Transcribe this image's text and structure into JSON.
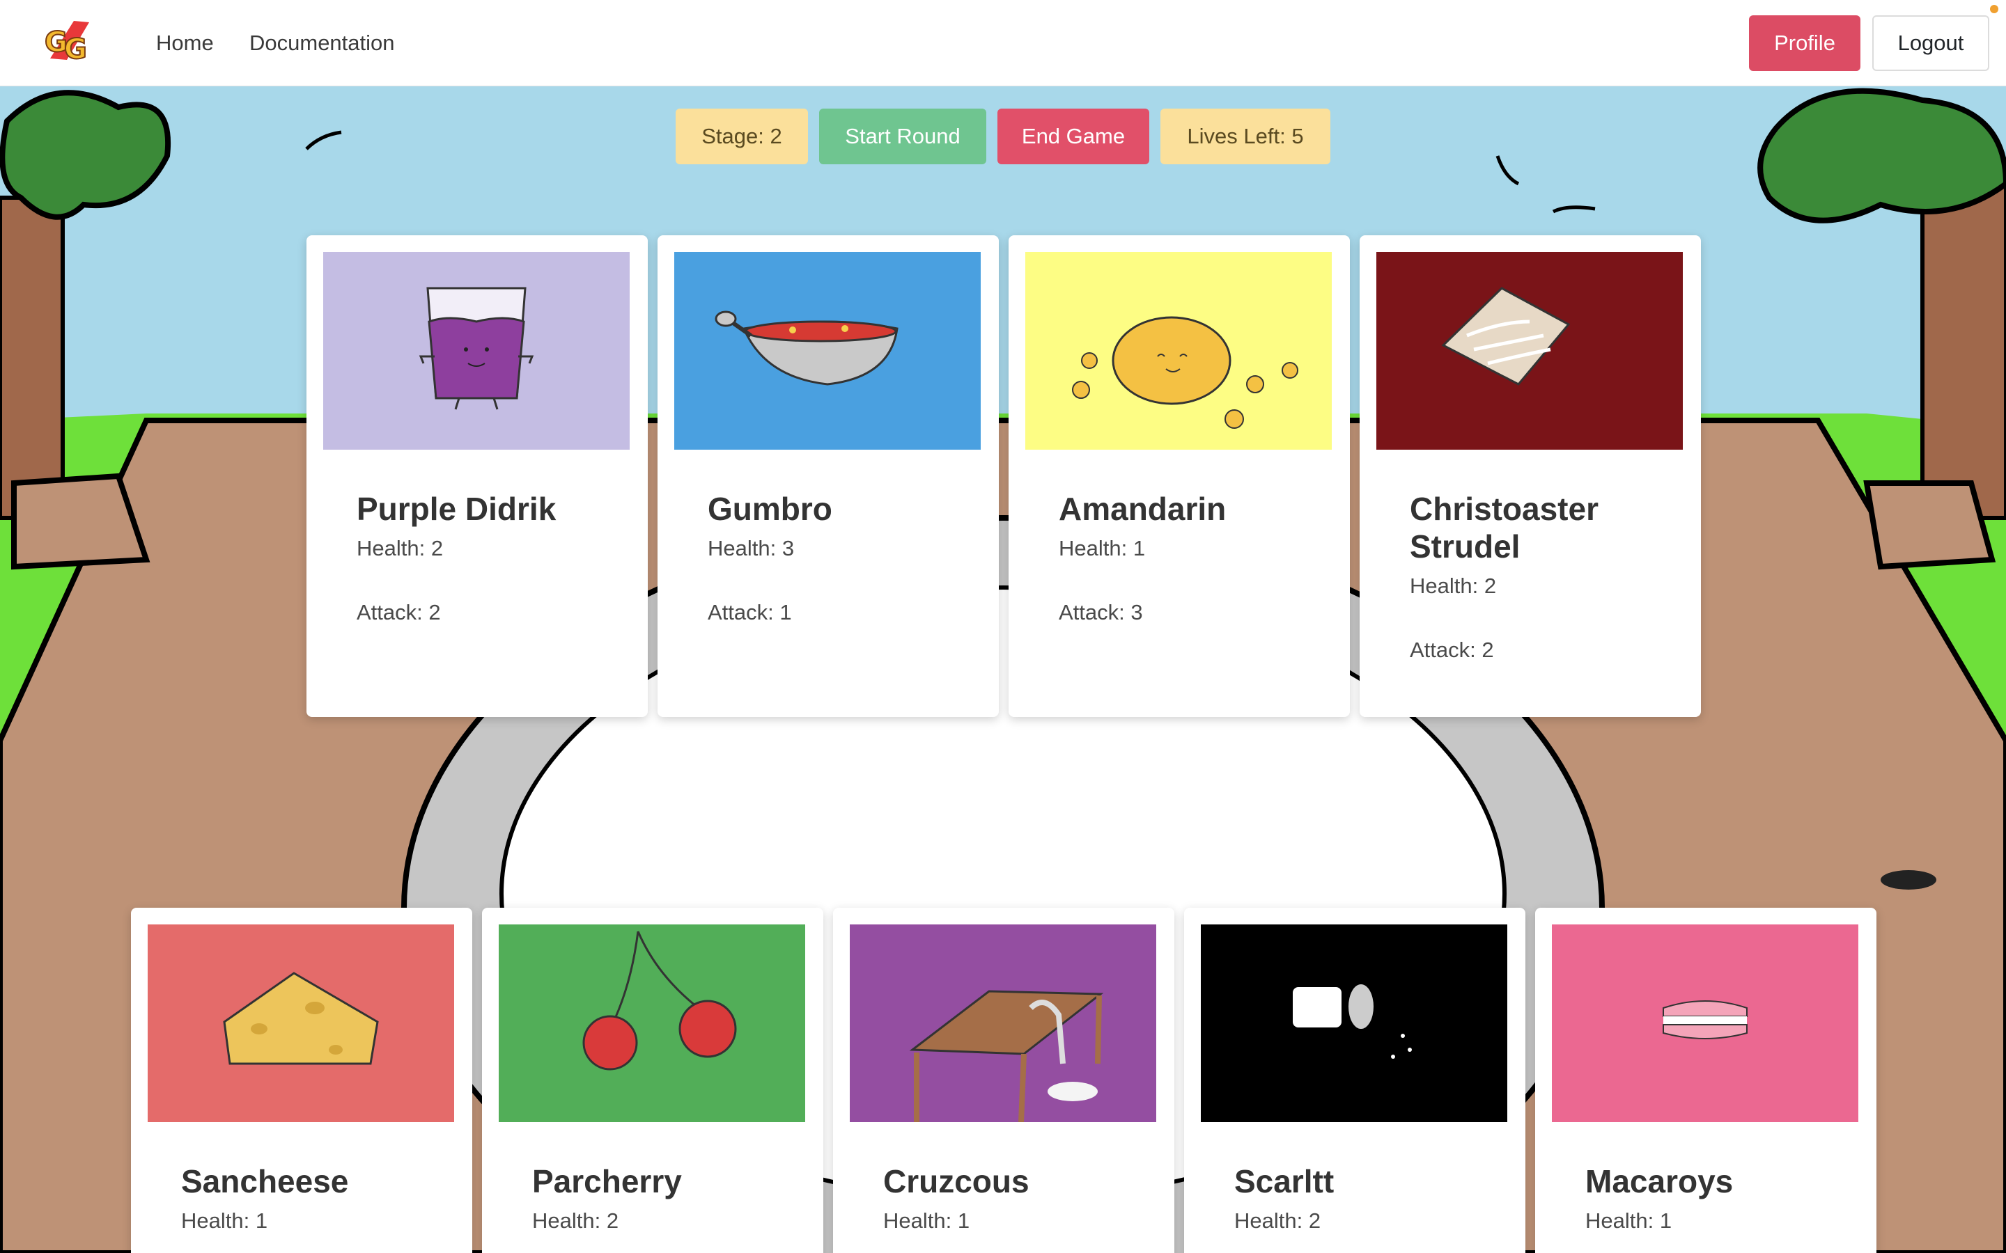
{
  "nav": {
    "home_label": "Home",
    "docs_label": "Documentation",
    "profile_label": "Profile",
    "logout_label": "Logout",
    "logo_icon": "gg-logo-icon"
  },
  "controls": {
    "stage_label": "Stage: 2",
    "start_label": "Start Round",
    "end_label": "End Game",
    "lives_label": "Lives Left: 5"
  },
  "colors": {
    "profile": "#dc4c64",
    "start": "#6fc590",
    "end": "#e15069",
    "badge": "#fbe09b"
  },
  "enemy_cards": [
    {
      "name": "Purple Didrik",
      "health": "Health: 2",
      "attack": "Attack: 2",
      "image_bg": "#c4bde3",
      "icon": "purple-drink-icon"
    },
    {
      "name": "Gumbro",
      "health": "Health: 3",
      "attack": "Attack: 1",
      "image_bg": "#4aa0e0",
      "icon": "gumbo-bowl-icon"
    },
    {
      "name": "Amandarin",
      "health": "Health: 1",
      "attack": "Attack: 3",
      "image_bg": "#fdfd84",
      "icon": "mandarin-icon"
    },
    {
      "name": "Christoaster Strudel",
      "health": "Health: 2",
      "attack": "Attack: 2",
      "image_bg": "#7a1418",
      "icon": "toaster-strudel-icon"
    }
  ],
  "player_cards": [
    {
      "name": "Sancheese",
      "health": "Health: 1",
      "image_bg": "#e46b6a",
      "icon": "cheese-wedge-icon"
    },
    {
      "name": "Parcherry",
      "health": "Health: 2",
      "image_bg": "#52ae58",
      "icon": "cherries-icon"
    },
    {
      "name": "Cruzcous",
      "health": "Health: 1",
      "image_bg": "#944ea1",
      "icon": "couscous-table-icon"
    },
    {
      "name": "Scarltt",
      "health": "Health: 2",
      "image_bg": "#000000",
      "icon": "salt-shaker-icon"
    },
    {
      "name": "Macaroys",
      "health": "Health: 1",
      "image_bg": "#eb6891",
      "icon": "macaron-icon"
    }
  ]
}
